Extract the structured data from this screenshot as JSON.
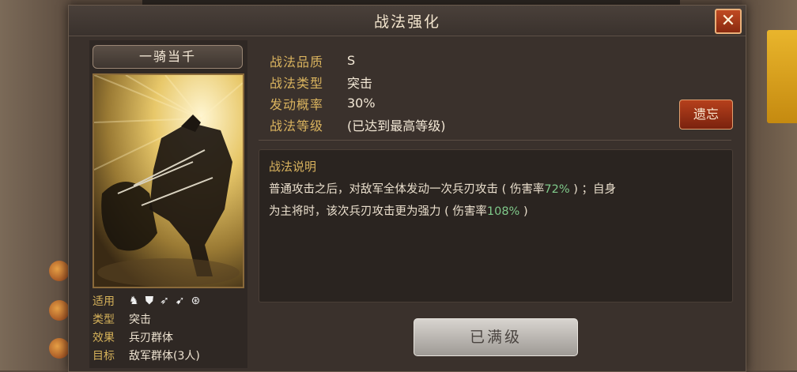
{
  "dialog": {
    "title": "战法强化",
    "close_icon": "close-icon"
  },
  "card": {
    "name": "一骑当千",
    "art": "cavalry-charge-illustration",
    "stats": {
      "suitable_label": "适用",
      "weapon_icons": [
        "cavalry-icon",
        "shield-icon",
        "bow-icon",
        "spear-icon",
        "siege-icon"
      ],
      "type_label": "类型",
      "type_value": "突击",
      "effect_label": "效果",
      "effect_value": "兵刃群体",
      "target_label": "目标",
      "target_value": "敌军群体(3人)"
    }
  },
  "info": {
    "quality_label": "战法品质",
    "quality_value": "S",
    "type_label": "战法类型",
    "type_value": "突击",
    "chance_label": "发动概率",
    "chance_value": "30%",
    "level_label": "战法等级",
    "level_value": "(已达到最高等级)"
  },
  "forget_button": "遗忘",
  "description": {
    "title": "战法说明",
    "line1_a": "普通攻击之后，对敌军全体发动一次兵刃攻击 ( 伤害率",
    "line1_rate": "72%",
    "line1_b": " ) ；自身",
    "line2_a": "为主将时，该次兵刃攻击更为强力 ( 伤害率",
    "line2_rate": "108%",
    "line2_b": " )"
  },
  "max_level_button": "已满级",
  "colors": {
    "accent_gold": "#d9b35e",
    "highlight_green": "#7fc98a",
    "button_red": "#b6401c"
  }
}
